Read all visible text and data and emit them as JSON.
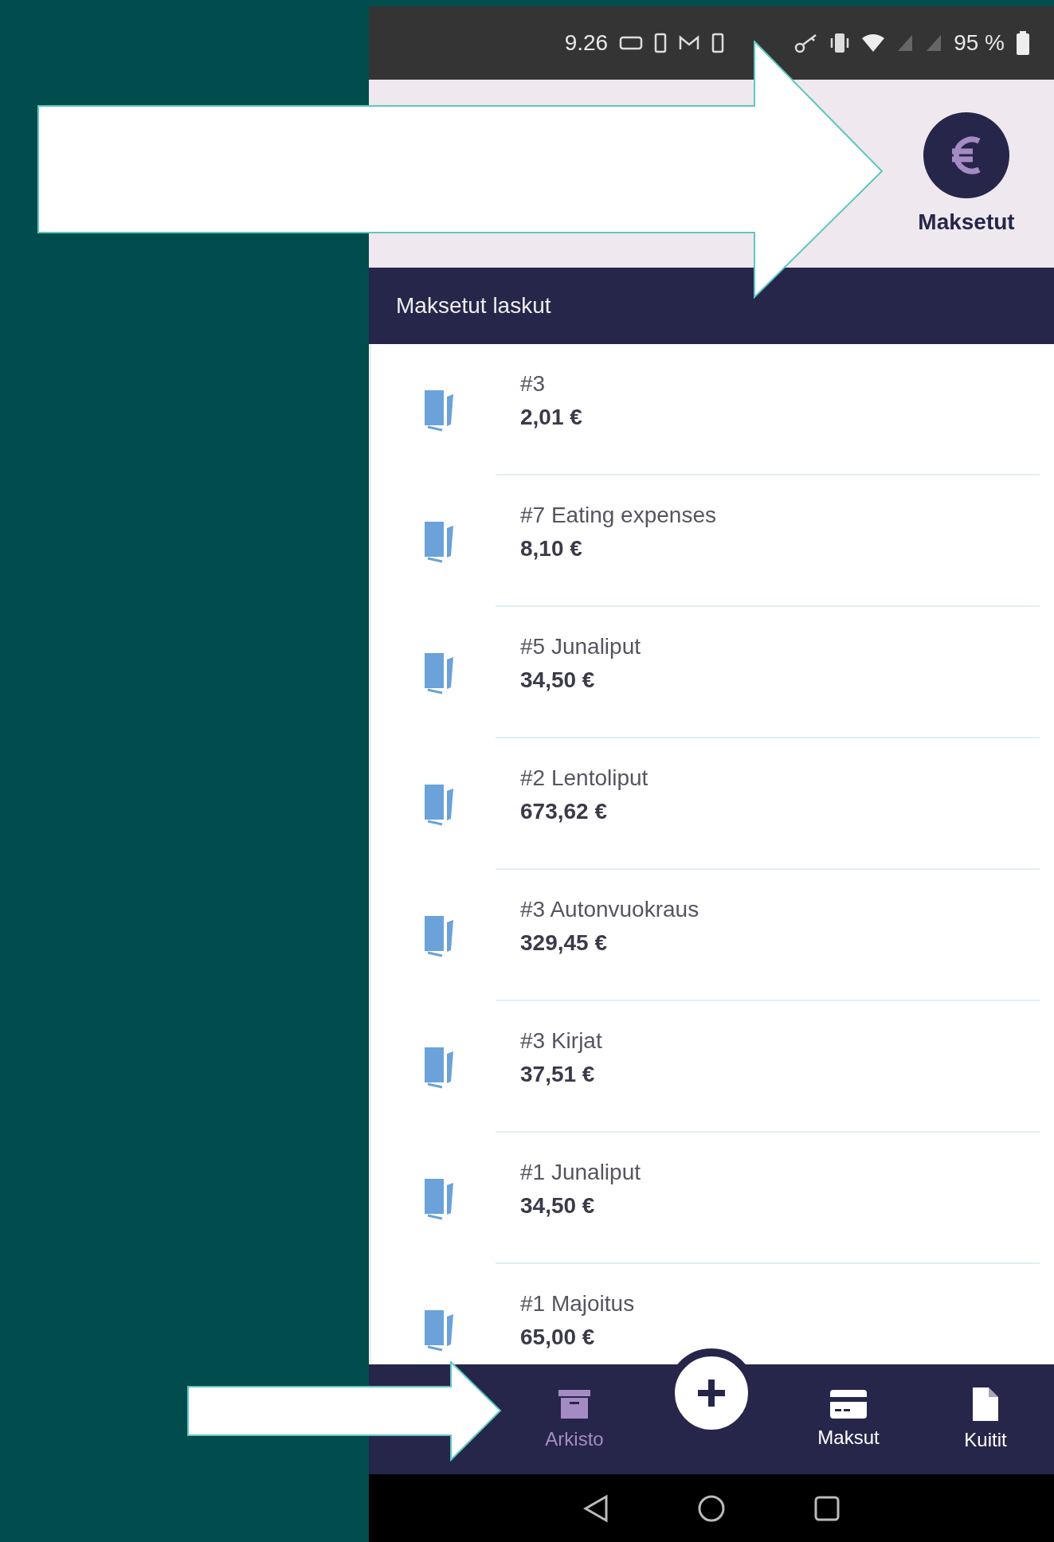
{
  "status_bar": {
    "time": "9.26",
    "battery": "95 %"
  },
  "tabs": [
    {
      "label": "Maksetut",
      "selected": true
    }
  ],
  "section": {
    "title": "Maksetut laskut"
  },
  "invoices": [
    {
      "title": "#3",
      "amount": "2,01 €"
    },
    {
      "title": "#7 Eating expenses",
      "amount": "8,10 €"
    },
    {
      "title": "#5 Junaliput",
      "amount": "34,50 €"
    },
    {
      "title": "#2 Lentoliput",
      "amount": "673,62 €"
    },
    {
      "title": "#3 Autonvuokraus",
      "amount": "329,45 €"
    },
    {
      "title": "#3 Kirjat",
      "amount": "37,51 €"
    },
    {
      "title": "#1 Junaliput",
      "amount": "34,50 €"
    },
    {
      "title": "#1 Majoitus",
      "amount": "65,00 €"
    }
  ],
  "bottom_nav": [
    {
      "kind": "archive",
      "label": "Arkisto",
      "selected": true
    },
    {
      "kind": "add"
    },
    {
      "kind": "card",
      "label": "Maksut",
      "selected": false
    },
    {
      "kind": "file",
      "label": "Kuitit",
      "selected": false
    }
  ]
}
